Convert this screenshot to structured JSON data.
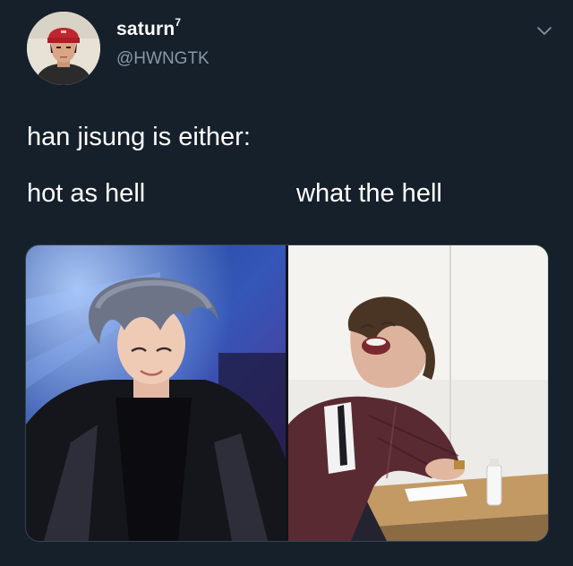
{
  "header": {
    "display_name": "saturn",
    "name_superscript": "7",
    "handle": "@HWNGTK",
    "avatar_icon": "profile-avatar",
    "menu_icon": "chevron-down-icon"
  },
  "tweet": {
    "text": "han jisung is either:",
    "left_label": "hot as hell",
    "right_label": "what the hell"
  },
  "media": {
    "left_photo": "stage-performance-photo",
    "right_photo": "laughing-classroom-photo"
  },
  "colors": {
    "background": "#15202b",
    "text": "#ffffff",
    "secondary_text": "#8b98a5",
    "border": "#38444d"
  }
}
